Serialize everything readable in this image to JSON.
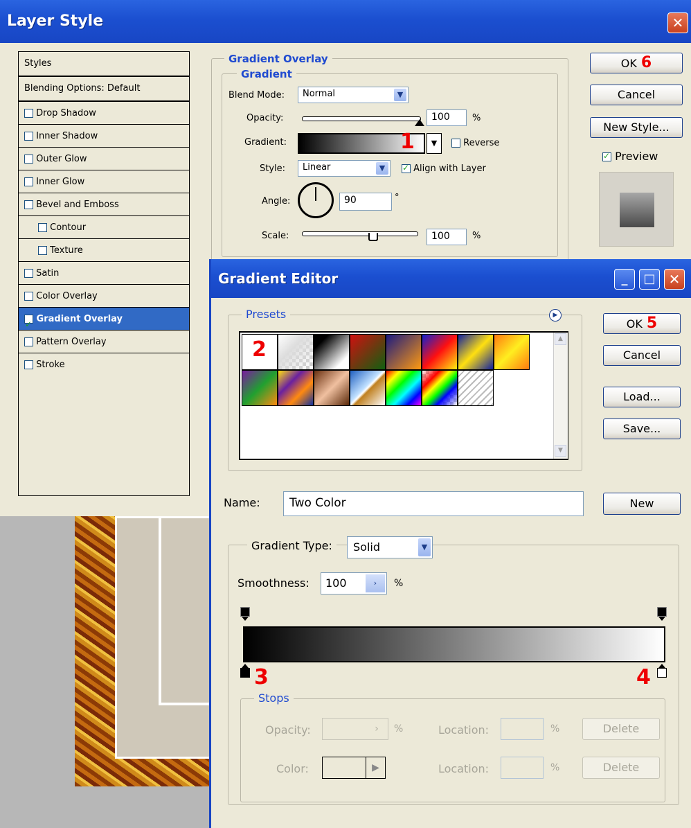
{
  "layer_style": {
    "title": "Layer Style",
    "styles_header": "Styles",
    "blending_options": "Blending Options: Default",
    "items": [
      {
        "label": "Drop Shadow",
        "checked": false
      },
      {
        "label": "Inner Shadow",
        "checked": false
      },
      {
        "label": "Outer Glow",
        "checked": false
      },
      {
        "label": "Inner Glow",
        "checked": false
      },
      {
        "label": "Bevel and Emboss",
        "checked": false
      },
      {
        "label": "Contour",
        "checked": false
      },
      {
        "label": "Texture",
        "checked": false
      },
      {
        "label": "Satin",
        "checked": false
      },
      {
        "label": "Color Overlay",
        "checked": false
      },
      {
        "label": "Gradient Overlay",
        "checked": true
      },
      {
        "label": "Pattern Overlay",
        "checked": false
      },
      {
        "label": "Stroke",
        "checked": false
      }
    ],
    "section_title": "Gradient Overlay",
    "subsection_title": "Gradient",
    "blend_mode_label": "Blend Mode:",
    "blend_mode_value": "Normal",
    "opacity_label": "Opacity:",
    "opacity_value": "100",
    "opacity_unit": "%",
    "opacity_level": 1.0,
    "gradient_label": "Gradient:",
    "reverse_label": "Reverse",
    "reverse_checked": false,
    "style_label": "Style:",
    "style_value": "Linear",
    "align_label": "Align with Layer",
    "align_checked": true,
    "angle_label": "Angle:",
    "angle_value": "90",
    "angle_unit": "°",
    "scale_label": "Scale:",
    "scale_value": "100",
    "scale_unit": "%",
    "ok_label": "OK",
    "cancel_label": "Cancel",
    "new_style_label": "New Style...",
    "preview_label": "Preview",
    "preview_checked": true
  },
  "gradient_editor": {
    "title": "Gradient Editor",
    "presets_label": "Presets",
    "ok_label": "OK",
    "cancel_label": "Cancel",
    "load_label": "Load...",
    "save_label": "Save...",
    "new_label": "New",
    "name_label": "Name:",
    "name_value": "Two Color",
    "gradient_type_label": "Gradient Type:",
    "gradient_type_value": "Solid",
    "smoothness_label": "Smoothness:",
    "smoothness_value": "100",
    "smoothness_unit": "%",
    "stops_label": "Stops",
    "stop_opacity_label": "Opacity:",
    "stop_opacity_unit": "%",
    "location_label": "Location:",
    "location_unit": "%",
    "delete_label": "Delete",
    "color_label": "Color:",
    "minimize_glyph": "_",
    "maximize_glyph": "□",
    "close_glyph": "✕"
  },
  "annotations": {
    "n1": "1",
    "n2": "2",
    "n3": "3",
    "n4": "4",
    "n5": "5",
    "n6": "6"
  },
  "colors": {
    "title_blue": "#1b4fd0",
    "panel": "#ece9d8",
    "selection": "#316ac5",
    "annotation_red": "#e00000"
  }
}
